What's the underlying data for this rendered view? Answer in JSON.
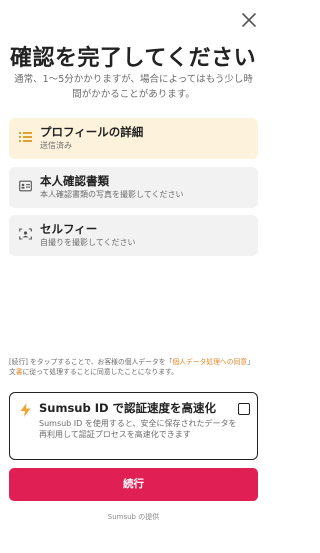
{
  "header": {
    "close_icon": "close-icon",
    "title": "確認を完了してください",
    "subtitle": "通常、1～5分かかりますが、場合によってはもう少し時間がかかることがあります。"
  },
  "steps": [
    {
      "title": "プロフィールの詳細",
      "description": "送信済み",
      "icon": "list-icon",
      "state": "active"
    },
    {
      "title": "本人確認書類",
      "description": "本人確認書類の写真を撮影してください",
      "icon": "id-card-icon",
      "state": "pending"
    },
    {
      "title": "セルフィー",
      "description": "自撮りを撮影してください",
      "icon": "face-scan-icon",
      "state": "pending"
    }
  ],
  "consent": {
    "prefix": "[続行] をタップすることで、お客様の個人データを「",
    "link": "個人データ処理への同意",
    "middle": "」文",
    "link2": "書",
    "suffix": "に従って処理することに同意したことになります。"
  },
  "sumsub_id": {
    "title": "Sumsub ID で認証速度を高速化",
    "description": "Sumsub ID を使用すると、安全に保存されたデータを再利用して認証プロセスを高速化できます",
    "checked": false
  },
  "continue_label": "続行",
  "footer": "Sumsub の提供",
  "colors": {
    "accent": "#e01f55",
    "active_card": "#fdf2dc",
    "link": "#e0892b",
    "bolt": "#f0a531"
  }
}
